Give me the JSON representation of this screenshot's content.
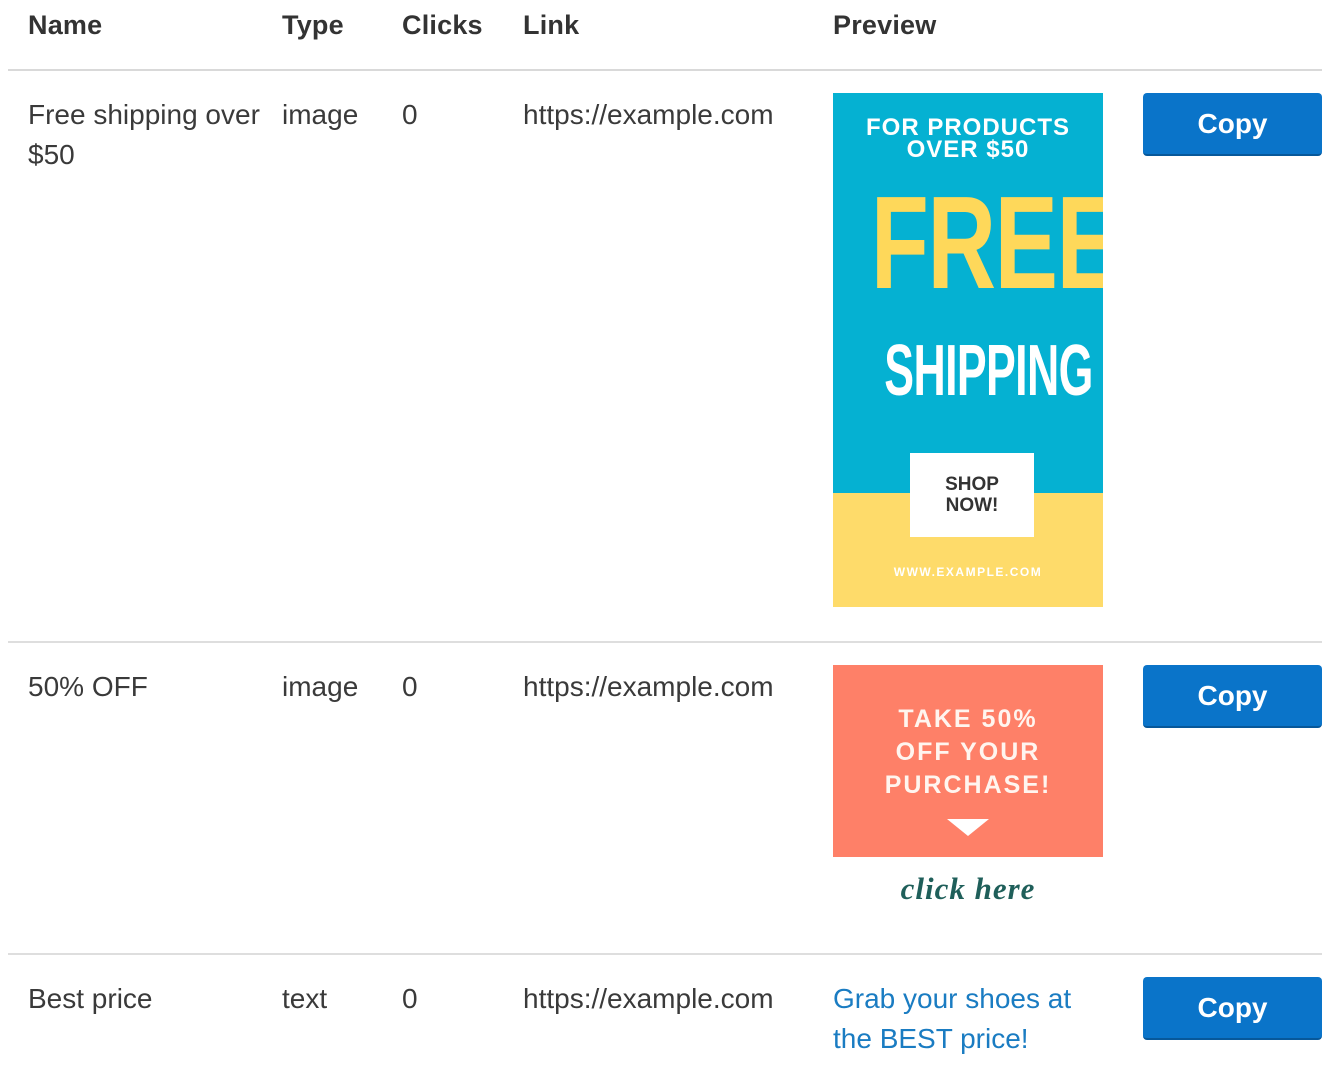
{
  "table": {
    "headers": {
      "name": "Name",
      "type": "Type",
      "clicks": "Clicks",
      "link": "Link",
      "preview": "Preview"
    },
    "rows": [
      {
        "name": "Free shipping over $50",
        "type": "image",
        "clicks": "0",
        "link": "https://example.com",
        "preview": {
          "kind": "image",
          "top_text_line1": "FOR PRODUCTS",
          "top_text_line2": "OVER $50",
          "headline": "FREE",
          "subheadline": "SHIPPING",
          "cta_line1": "SHOP",
          "cta_line2": "NOW!",
          "url": "WWW.EXAMPLE.COM"
        },
        "copy_label": "Copy"
      },
      {
        "name": "50% OFF",
        "type": "image",
        "clicks": "0",
        "link": "https://example.com",
        "preview": {
          "kind": "image",
          "line1": "TAKE 50%",
          "line2": "OFF YOUR",
          "line3": "PURCHASE!",
          "caption": "click here"
        },
        "copy_label": "Copy"
      },
      {
        "name": "Best price",
        "type": "text",
        "clicks": "0",
        "link": "https://example.com",
        "preview": {
          "kind": "text",
          "text": "Grab your shoes at the BEST price!"
        },
        "copy_label": "Copy"
      }
    ]
  },
  "colors": {
    "button": "#0a74c9",
    "link_text": "#1a7cc2",
    "banner1_blue": "#05b1d2",
    "banner1_yellow": "#fedb6a",
    "banner2_coral": "#fe8068"
  }
}
